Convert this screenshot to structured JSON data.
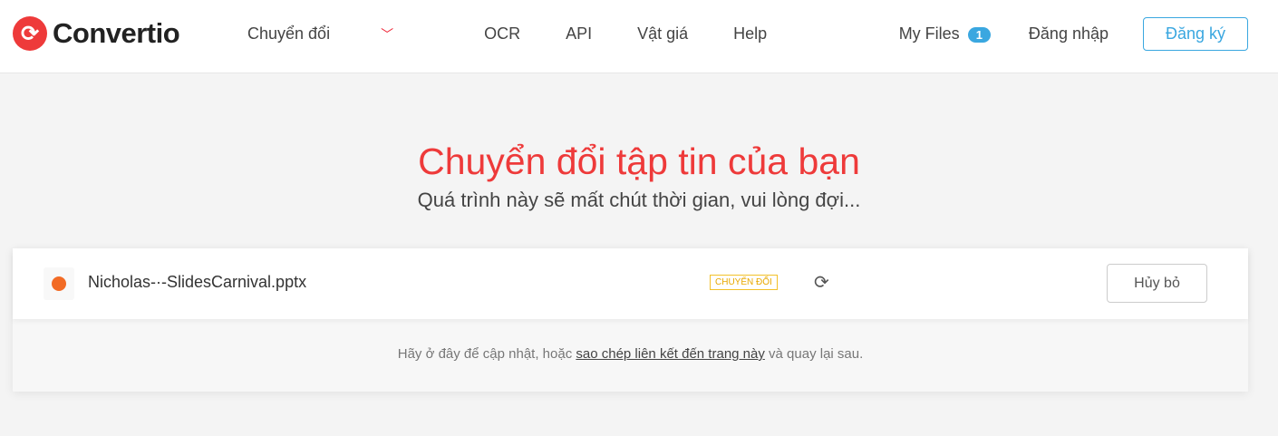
{
  "header": {
    "logo": "Convertio",
    "nav": [
      "Chuyển đổi",
      "OCR",
      "API",
      "Vật giá",
      "Help"
    ],
    "my_files": "My Files",
    "files_count": "1",
    "login": "Đăng nhập",
    "signup": "Đăng ký"
  },
  "hero": {
    "title": "Chuyển đổi tập tin của bạn",
    "subtitle": "Quá trình này sẽ mất chút thời gian, vui lòng đợi..."
  },
  "file": {
    "name": "Nicholas-·-SlidesCarnival.pptx",
    "status": "CHUYỂN ĐỔI",
    "cancel": "Hủy bỏ"
  },
  "note": {
    "before": "Hãy ở đây để cập nhật, hoặc ",
    "link": "sao chép liên kết đến trang này",
    "after": " và quay lại sau."
  }
}
